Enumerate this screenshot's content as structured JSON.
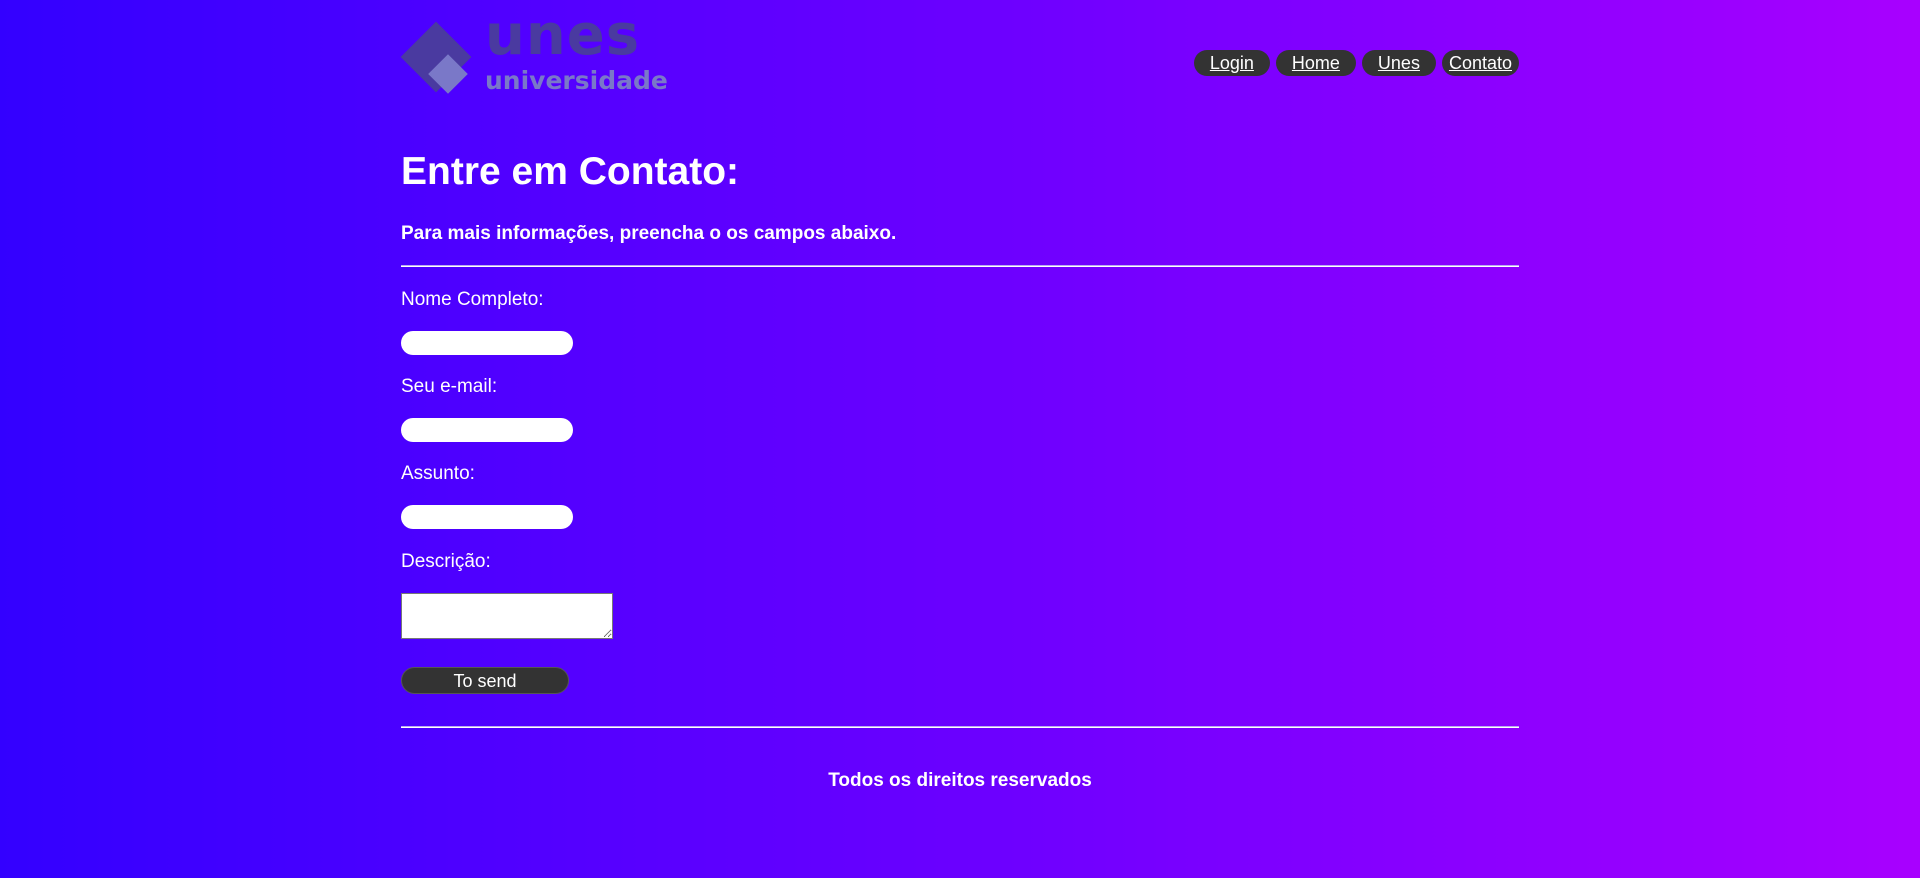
{
  "logo": {
    "word": "unes",
    "sub": "universidade"
  },
  "nav": {
    "items": [
      "Login",
      "Home",
      "Unes",
      "Contato"
    ]
  },
  "page": {
    "title": "Entre em Contato:",
    "subtitle": "Para mais informações, preencha o os campos abaixo."
  },
  "form": {
    "name_label": "Nome Completo:",
    "email_label": "Seu e-mail:",
    "subject_label": "Assunto:",
    "description_label": "Descrição:",
    "name_value": "",
    "email_value": "",
    "subject_value": "",
    "description_value": "",
    "send_label": "To send"
  },
  "footer": {
    "text": "Todos os direitos reservados"
  },
  "colors": {
    "gradient_start": "#3300ff",
    "gradient_end": "#a800ff",
    "nav_pill": "#333333",
    "logo_dark": "#4a3aa0",
    "logo_light": "#7a78c8"
  }
}
